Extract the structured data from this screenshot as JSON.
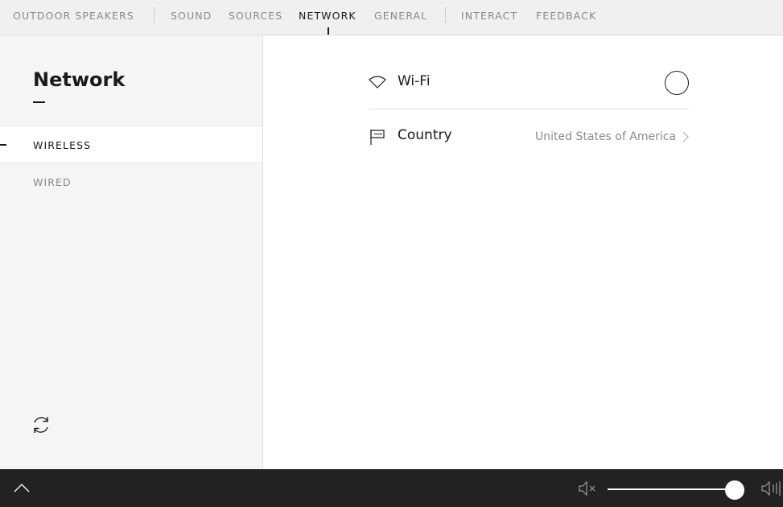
{
  "topnav": {
    "device_name": "OUTDOOR SPEAKERS",
    "tabs": [
      {
        "label": "SOUND"
      },
      {
        "label": "SOURCES"
      },
      {
        "label": "NETWORK"
      },
      {
        "label": "GENERAL"
      }
    ],
    "extra_tabs": [
      {
        "label": "INTERACT"
      },
      {
        "label": "FEEDBACK"
      }
    ],
    "active_tab": "NETWORK"
  },
  "sidebar": {
    "title": "Network",
    "items": [
      {
        "label": "WIRELESS",
        "active": true
      },
      {
        "label": "WIRED",
        "active": false
      }
    ],
    "refresh_icon": "refresh-icon"
  },
  "settings": {
    "wifi": {
      "label": "Wi-Fi",
      "icon": "wifi-icon",
      "enabled": false
    },
    "country": {
      "label": "Country",
      "icon": "flag-icon",
      "value": "United States of America"
    }
  },
  "player": {
    "volume": 0.95,
    "icons": [
      "chevron-up-icon",
      "mute-icon",
      "volume-max-icon"
    ]
  },
  "colors": {
    "nav_bg": "#f0f0f0",
    "sidebar_bg": "#f5f5f5",
    "bottom_bar": "#222222",
    "text_active": "#1a1a1a",
    "text_muted": "#8a8a8a"
  }
}
